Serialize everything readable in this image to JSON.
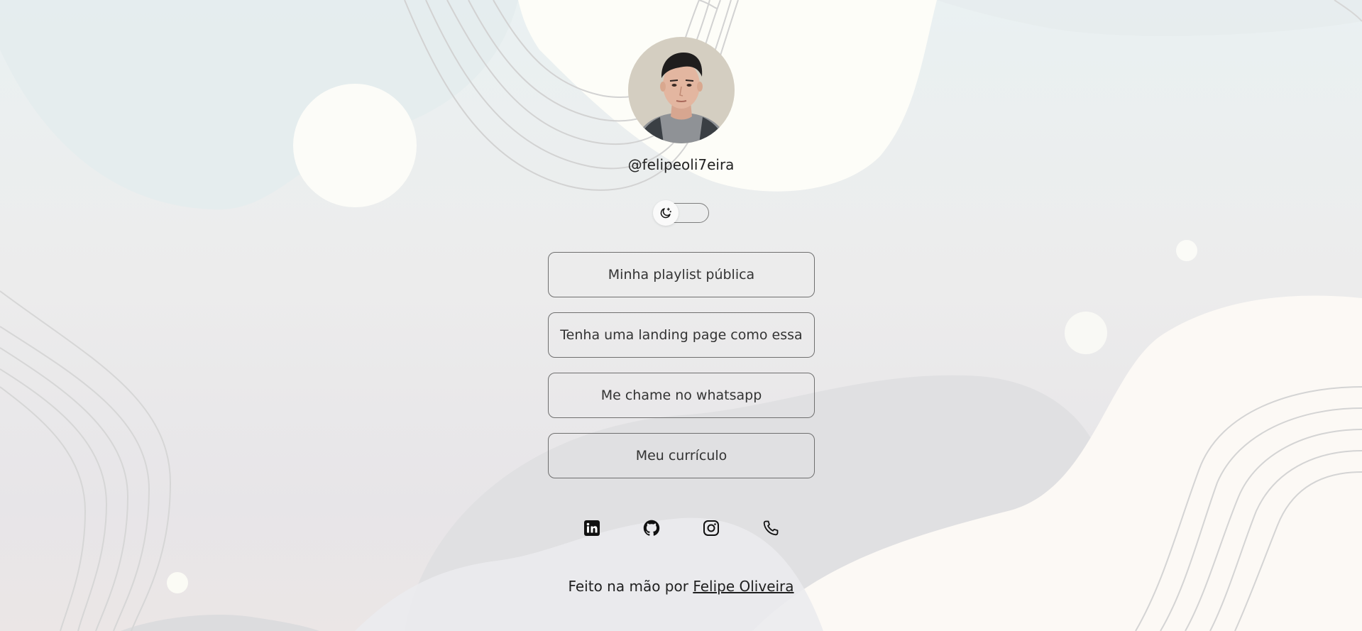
{
  "profile": {
    "username": "@felipeoli7eira",
    "avatar_icon": "profile-photo"
  },
  "theme_toggle": {
    "icon": "moon-icon"
  },
  "links": [
    {
      "label": "Minha playlist pública"
    },
    {
      "label": "Tenha uma landing page como essa"
    },
    {
      "label": "Me chame no whatsapp"
    },
    {
      "label": "Meu currículo"
    }
  ],
  "social": [
    {
      "icon": "linkedin-icon"
    },
    {
      "icon": "github-icon"
    },
    {
      "icon": "instagram-icon"
    },
    {
      "icon": "phone-icon"
    }
  ],
  "footer": {
    "prefix": "Feito na mão por",
    "author": "Felipe Oliveira"
  }
}
